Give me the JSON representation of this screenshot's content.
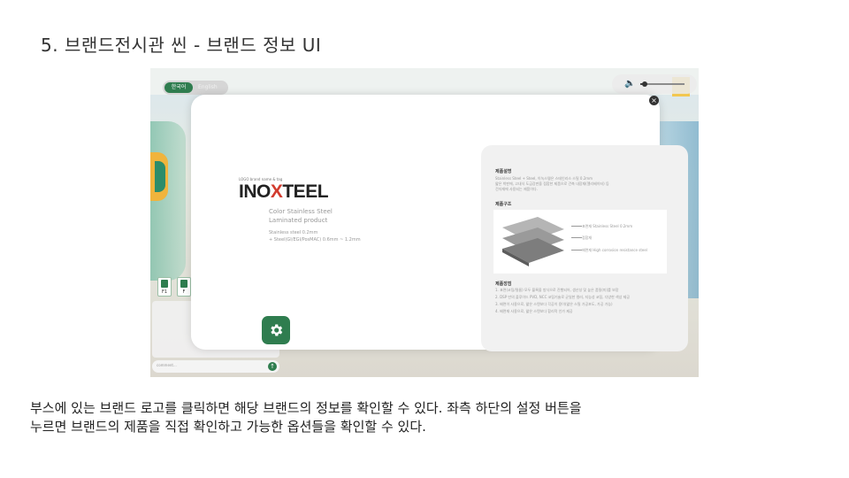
{
  "slide": {
    "title": "5. 브랜드전시관 씬 - 브랜드 정보 UI",
    "caption_line1": "부스에 있는 브랜드 로고를 클릭하면 해당 브랜드의 정보를 확인할 수 있다. 좌측 하단의 설정 버튼을",
    "caption_line2": "누르면 브랜드의 제품을 직접 확인하고 가능한 옵션들을 확인할 수 있다."
  },
  "app": {
    "language": {
      "ko": "한국어",
      "en": "English",
      "selected": "ko"
    },
    "volume": {
      "icon": "speaker-icon",
      "level": 0.1
    },
    "booth_icons": [
      {
        "icon": "booth-icon",
        "label": "F1"
      },
      {
        "icon": "booth-icon",
        "label": "F"
      }
    ],
    "chat": {
      "placeholder": "comment...",
      "send_icon": "send-icon"
    },
    "modal": {
      "close_icon": "close-icon",
      "brand": {
        "tag": "LOGO brand name & tag",
        "logo_prefix": "INO",
        "logo_x": "X",
        "logo_suffix": "TEEL",
        "subtitle_1": "Color Stainless Steel",
        "subtitle_2": "Laminated product",
        "spec_1": "Stainless steel 0.2mm",
        "spec_2": "+ Steel(GI/EGI/PosMAC) 0.6mm ~ 1.2mm"
      },
      "settings_icon": "gear-icon",
      "card": {
        "section1_title": "제품설명",
        "section1_text_1": "Stainless Steel + Steel, 이녹스텔은 스테인리스 스틸 0.2mm",
        "section1_text_2": "얇은 박판에, 고내식 도금강판을 접합한 제품으로 건축 내장재(엘리베이터) 등",
        "section1_text_3": "건자재에 사용되는 제품이다.",
        "section2_title": "제품구조",
        "layers": [
          "표면재 Stainless Steel 0.2mm",
          "접합재",
          "배면재 High corrosion resistance steel"
        ],
        "section3_title": "제품장점",
        "advantages": [
          "1. 표면(코팅/필름) 모두 블록을 방식으로 진행되어, 생산성 및 높은 품질(미)를 보장",
          "2. DSP 만의 플루이드 PVD, NCC 코팅기술로 균일한 컬러, 지능성 코팅, 다양한 색상 제공",
          "3. 배면이 사용으로, 얇은 스텐보다 각공이 용이(얇은 스틸 가공포도, 가공 가능)",
          "4. 배면재 사용으로, 얇은 스텐보다 합리적 인가 제공"
        ]
      }
    }
  }
}
